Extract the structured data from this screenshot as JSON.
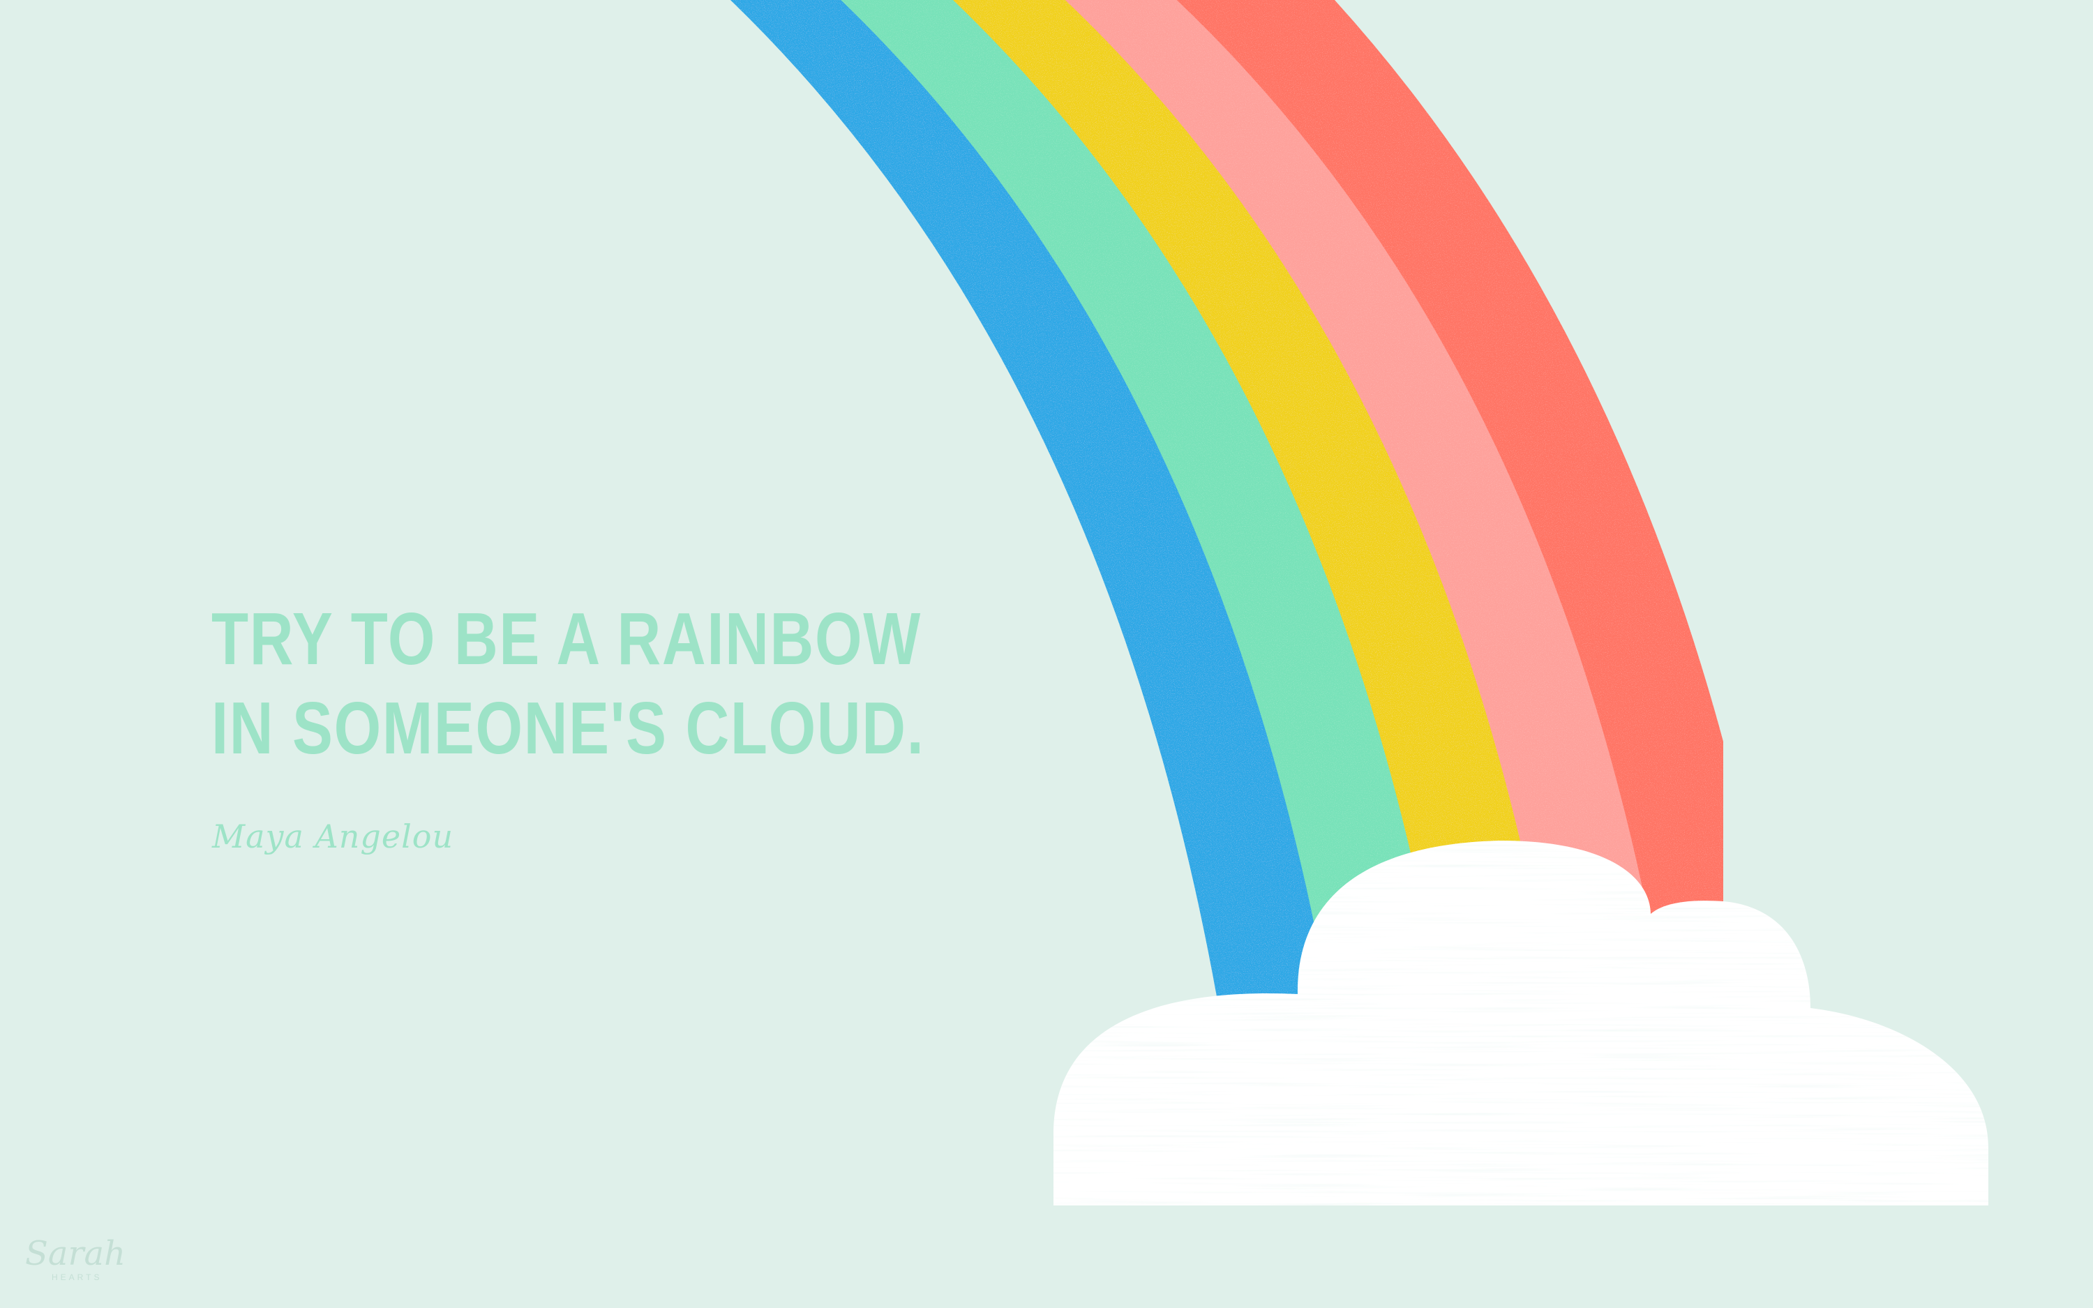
{
  "quote": {
    "line1": "TRY TO BE A RAINBOW",
    "line2": "IN SOMEONE'S CLOUD."
  },
  "author": "Maya Angelou",
  "logo": {
    "script": "Sarah",
    "sub": "HEARTS"
  },
  "colors": {
    "background": "#dff0ea",
    "text": "#9de3c7",
    "rainbow": [
      "#2fa8e6",
      "#78e2b9",
      "#f1d11d",
      "#fea19b",
      "#ff7565"
    ],
    "cloud": "#ffffff"
  }
}
